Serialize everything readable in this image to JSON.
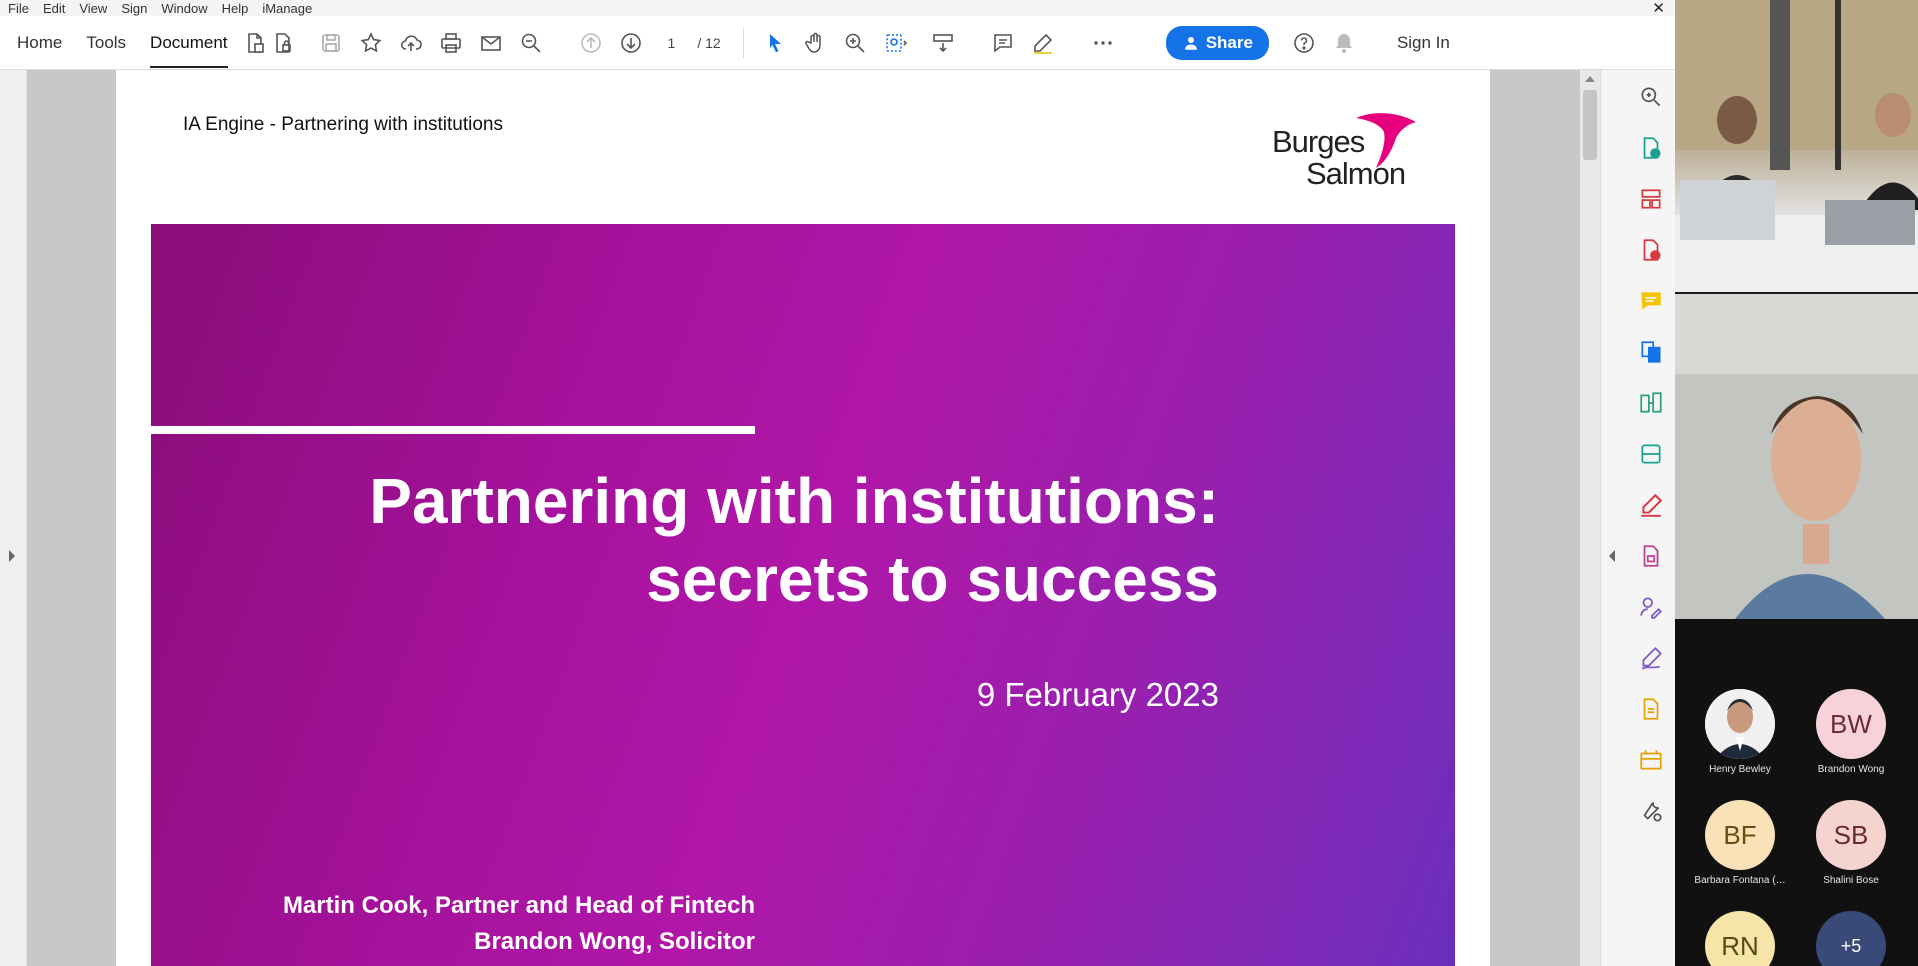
{
  "menu": {
    "items": [
      "File",
      "Edit",
      "View",
      "Sign",
      "Window",
      "Help",
      "iManage"
    ],
    "close_glyph": "✕"
  },
  "toolbar": {
    "tabs": [
      "Home",
      "Tools",
      "Document"
    ],
    "active_tab": "Document",
    "page": {
      "current": "1",
      "total": "/ 12"
    },
    "share_label": "Share",
    "signin_label": "Sign In",
    "icons": [
      "create-pdf-icon",
      "protect-pdf-icon",
      "save-icon",
      "bookmark-star-icon",
      "upload-cloud-icon",
      "print-icon",
      "email-icon",
      "zoom-out-icon",
      "page-up-icon",
      "page-down-icon",
      "select-cursor-icon",
      "hand-tool-icon",
      "zoom-in-icon",
      "marquee-zoom-icon",
      "keyboard-tool-icon",
      "comment-icon",
      "pen-highlight-icon",
      "more-icon",
      "help-icon",
      "notification-bell-icon"
    ]
  },
  "document": {
    "header_text": "IA Engine - Partnering with institutions",
    "logo": {
      "line1": "Burges",
      "line2": "Salmon",
      "accent_color": "#e6007e"
    },
    "slide": {
      "title_line1": "Partnering with institutions:",
      "title_line2": "secrets to success",
      "date": "9 February 2023",
      "author1": "Martin Cook, Partner and Head of Fintech",
      "author2": "Brandon Wong, Solicitor"
    }
  },
  "right_panel": {
    "icons": [
      "search-zoom-icon",
      "export-pdf-icon",
      "organize-pages-icon",
      "add-page-icon",
      "comment-tool-icon",
      "combine-files-icon",
      "compare-files-icon",
      "scan-ocr-icon",
      "fill-sign-icon",
      "protect-icon",
      "request-signature-icon",
      "edit-pdf-icon",
      "send-review-icon",
      "stamp-icon",
      "more-tools-icon"
    ]
  },
  "video": {
    "participants": [
      {
        "initials": "",
        "name": "Henry Bewley",
        "photo": true
      },
      {
        "initials": "BW",
        "name": "Brandon Wong"
      },
      {
        "initials": "BF",
        "name": "Barbara Fontana (…"
      },
      {
        "initials": "SB",
        "name": "Shalini Bose"
      },
      {
        "initials": "RN",
        "name": ""
      },
      {
        "initials": "+5",
        "name": ""
      }
    ]
  },
  "colors": {
    "accent_blue": "#1473e6",
    "slide_magenta": "#b017a8",
    "slide_purple": "#6b2fbd"
  }
}
